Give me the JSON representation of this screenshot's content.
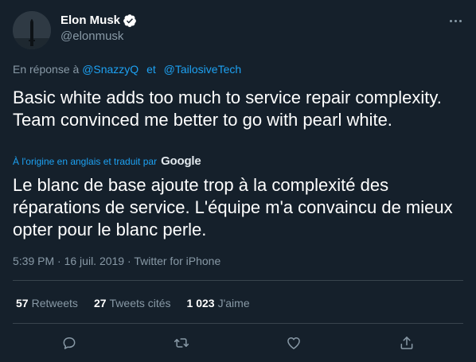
{
  "author": {
    "display_name": "Elon Musk",
    "handle": "@elonmusk",
    "verified": true,
    "avatar_icon": "starship-avatar-icon"
  },
  "reply": {
    "prefix": "En réponse à",
    "mentions": [
      "@SnazzyQ",
      "@TailosiveTech"
    ],
    "joiner": "et"
  },
  "tweet": {
    "text": "Basic white adds too much to service repair complexity. Team convinced me better to go with pearl white.",
    "translation_note": "À l'origine en anglais et traduit par",
    "translation_provider": "Google",
    "translated_text": "Le blanc de base ajoute trop à la complexité des réparations de service. L'équipe m'a convaincu de mieux opter pour le blanc perle."
  },
  "meta": {
    "time": "5:39 PM",
    "date": "16 juil. 2019",
    "source": "Twitter for iPhone",
    "separator": "·"
  },
  "stats": {
    "retweets_count": "57",
    "retweets_label": "Retweets",
    "quotes_count": "27",
    "quotes_label": "Tweets cités",
    "likes_count": "1 023",
    "likes_label": "J'aime"
  },
  "actions": [
    "reply-icon",
    "retweet-icon",
    "like-icon",
    "share-icon"
  ],
  "colors": {
    "background": "#15202b",
    "link": "#1da1f2",
    "muted": "#8899a6",
    "divider": "#38444d",
    "text": "#ffffff"
  }
}
